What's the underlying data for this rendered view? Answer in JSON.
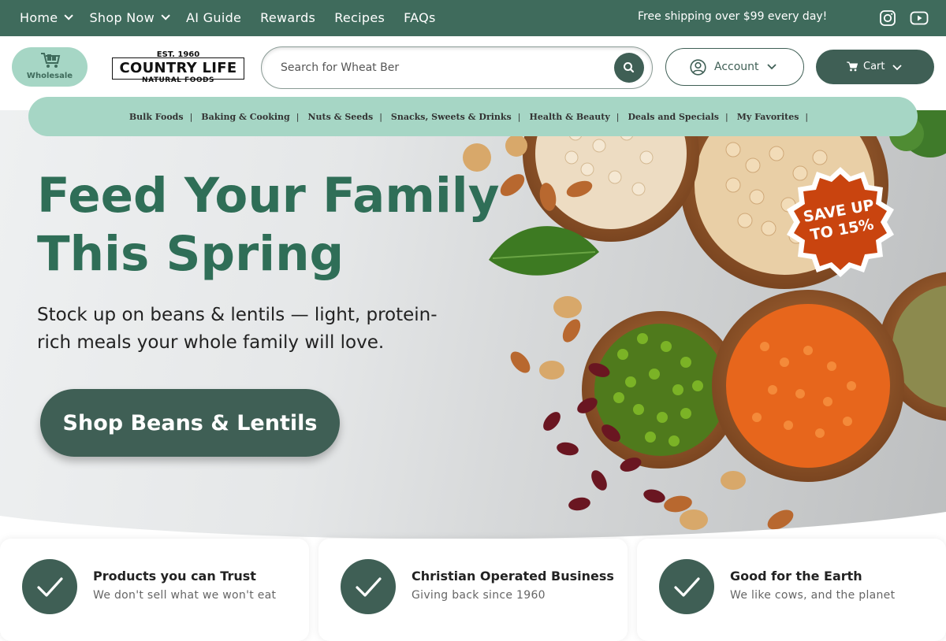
{
  "top_nav": {
    "items": [
      {
        "label": "Home",
        "has_dropdown": true
      },
      {
        "label": "Shop Now",
        "has_dropdown": true
      },
      {
        "label": "AI Guide",
        "has_dropdown": false
      },
      {
        "label": "Rewards",
        "has_dropdown": false
      },
      {
        "label": "Recipes",
        "has_dropdown": false
      },
      {
        "label": "FAQs",
        "has_dropdown": false
      }
    ],
    "shipping_text": "Free shipping over $99 every day!",
    "social_icons": [
      "instagram-icon",
      "youtube-icon"
    ]
  },
  "header": {
    "wholesale_label": "Wholesale",
    "logo": {
      "est": "EST. 1960",
      "name": "COUNTRY LIFE",
      "sub": "NATURAL FOODS"
    },
    "search": {
      "value": "Search for Wheat Ber",
      "icon": "search-icon"
    },
    "account_label": "Account",
    "cart_label": "Cart"
  },
  "categories": [
    "Bulk Foods",
    "Baking & Cooking",
    "Nuts & Seeds",
    "Snacks, Sweets & Drinks",
    "Health & Beauty",
    "Deals and Specials",
    "My Favorites"
  ],
  "category_separator": "|",
  "hero": {
    "headline_1": "Feed Your Family",
    "headline_2": "This Spring",
    "subline": "Stock up on beans & lentils — light, protein-rich meals your whole family will love.",
    "cta_label": "Shop Beans & Lentils",
    "badge_line_1": "SAVE UP",
    "badge_line_2": "TO 15%"
  },
  "features": [
    {
      "title": "Products you can Trust",
      "subtitle": "We don't sell what we won't eat"
    },
    {
      "title": "Christian Operated Business",
      "subtitle": "Giving back since 1960"
    },
    {
      "title": "Good for the Earth",
      "subtitle": "We like cows, and the planet"
    }
  ],
  "colors": {
    "brand_green": "#3f6b5c",
    "button_green": "#3f5f55",
    "mint": "#a6d6c5",
    "headline_green": "#2f6e57",
    "badge_orange": "#c9440f"
  }
}
